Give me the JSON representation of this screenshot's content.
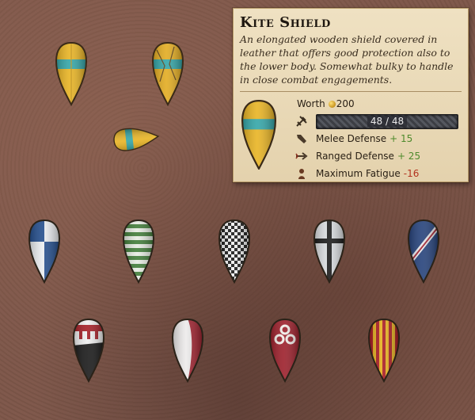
{
  "tooltip": {
    "title": "Kite Shield",
    "description": "An elongated wooden shield covered in leather that offers good protection also to the lower body. Somewhat bulky to handle in close combat engagements.",
    "worth_label": "Worth",
    "worth_value": "200",
    "durability": "48 / 48",
    "stats": [
      {
        "label": "Melee Defense",
        "value": "+ 15",
        "icon": "melee-defense-icon"
      },
      {
        "label": "Ranged Defense",
        "value": "+ 25",
        "icon": "ranged-defense-icon"
      },
      {
        "label": "Maximum Fatigue",
        "value": "-16",
        "icon": "fatigue-icon"
      }
    ]
  },
  "colors": {
    "tooltip_bg": "#e8d8b6",
    "positive": "#4e8a2c",
    "negative": "#b3331f",
    "shield_yellow": "#e8b21e",
    "shield_teal": "#2fa4a6"
  },
  "shields": [
    {
      "name": "kite-shield-yellow-teal-front",
      "design": "yellow-teal-band"
    },
    {
      "name": "kite-shield-yellow-teal-damaged",
      "design": "yellow-teal-band-damaged"
    },
    {
      "name": "kite-shield-yellow-teal-fallen",
      "design": "yellow-teal-band-sideways"
    },
    {
      "name": "kite-shield-blue-white-quartered",
      "design": "quartered-blue-white"
    },
    {
      "name": "kite-shield-green-white-striped",
      "design": "green-white-stripes"
    },
    {
      "name": "kite-shield-black-white-checkered",
      "design": "checkered"
    },
    {
      "name": "kite-shield-black-cross",
      "design": "black-cross-on-white"
    },
    {
      "name": "kite-shield-blue-red-bend",
      "design": "blue-with-red-bend"
    },
    {
      "name": "kite-shield-black-white-red-chief",
      "design": "red-chief-white-black"
    },
    {
      "name": "kite-shield-red-white-split",
      "design": "red-white-per-pale"
    },
    {
      "name": "kite-shield-red-three-rings",
      "design": "red-three-rings"
    },
    {
      "name": "kite-shield-red-yellow-stripes",
      "design": "red-yellow-pales"
    }
  ]
}
